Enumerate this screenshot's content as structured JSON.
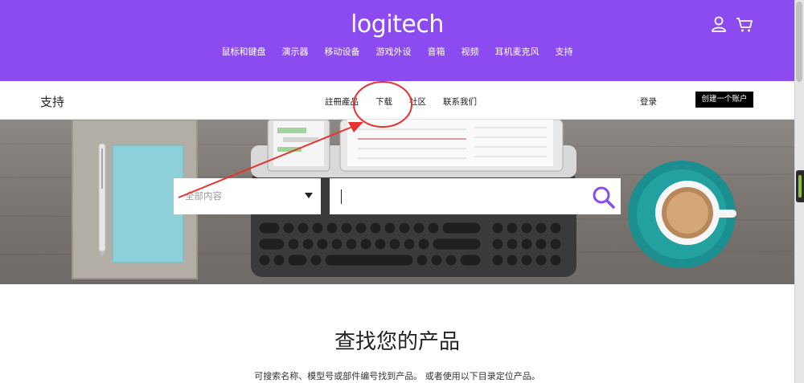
{
  "header": {
    "logo": "logitech",
    "nav": [
      "鼠标和键盘",
      "演示器",
      "移动设备",
      "游戏外设",
      "音箱",
      "视频",
      "耳机麦克风",
      "支持"
    ],
    "icons": [
      "user-icon",
      "cart-icon"
    ]
  },
  "subbar": {
    "title": "支持",
    "nav": [
      "註冊產品",
      "下载",
      "社区",
      "联系我们"
    ],
    "login": "登录",
    "create_account": "创建一个账户"
  },
  "search": {
    "category": "全部内容",
    "placeholder": ""
  },
  "content": {
    "title": "查找您的产品",
    "subtitle": "可搜索名称、模型号或部件编号找到产品。 或者使用以下目录定位产品。"
  },
  "colors": {
    "brand_purple": "#8c4bf0",
    "annotation_red": "#e8322f",
    "teal_saucer": "#1b8f8f"
  }
}
